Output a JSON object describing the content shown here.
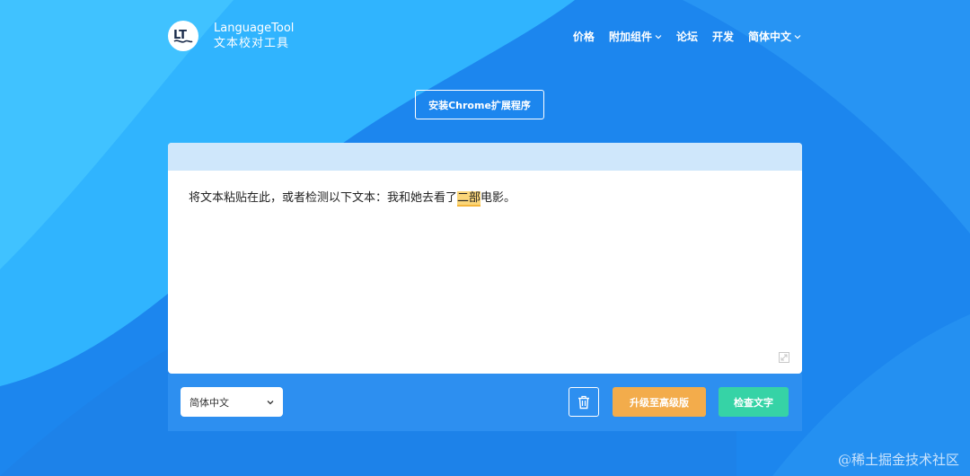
{
  "brand": {
    "name": "LanguageTool",
    "subtitle": "文本校对工具",
    "logo_text": "LT"
  },
  "nav": {
    "items": [
      {
        "label": "价格"
      },
      {
        "label": "附加组件"
      },
      {
        "label": "论坛"
      },
      {
        "label": "开发"
      },
      {
        "label": "简体中文"
      }
    ]
  },
  "install_button": {
    "label": "安装Chrome扩展程序"
  },
  "editor": {
    "text_before": "将文本粘贴在此，或者检测以下文本：我和她去看了",
    "text_highlight": "二部",
    "text_after": "电影。"
  },
  "toolbar": {
    "language_value": "简体中文",
    "upgrade_label": "升级至高级版",
    "check_label": "检查文字"
  },
  "watermark": "@稀土掘金技术社区",
  "colors": {
    "background": "#1d8cf0",
    "editor_toolbar": "#cfe7fb",
    "highlight": "#fbd679",
    "upgrade": "#f3ac4b",
    "check": "#36d3a6"
  }
}
